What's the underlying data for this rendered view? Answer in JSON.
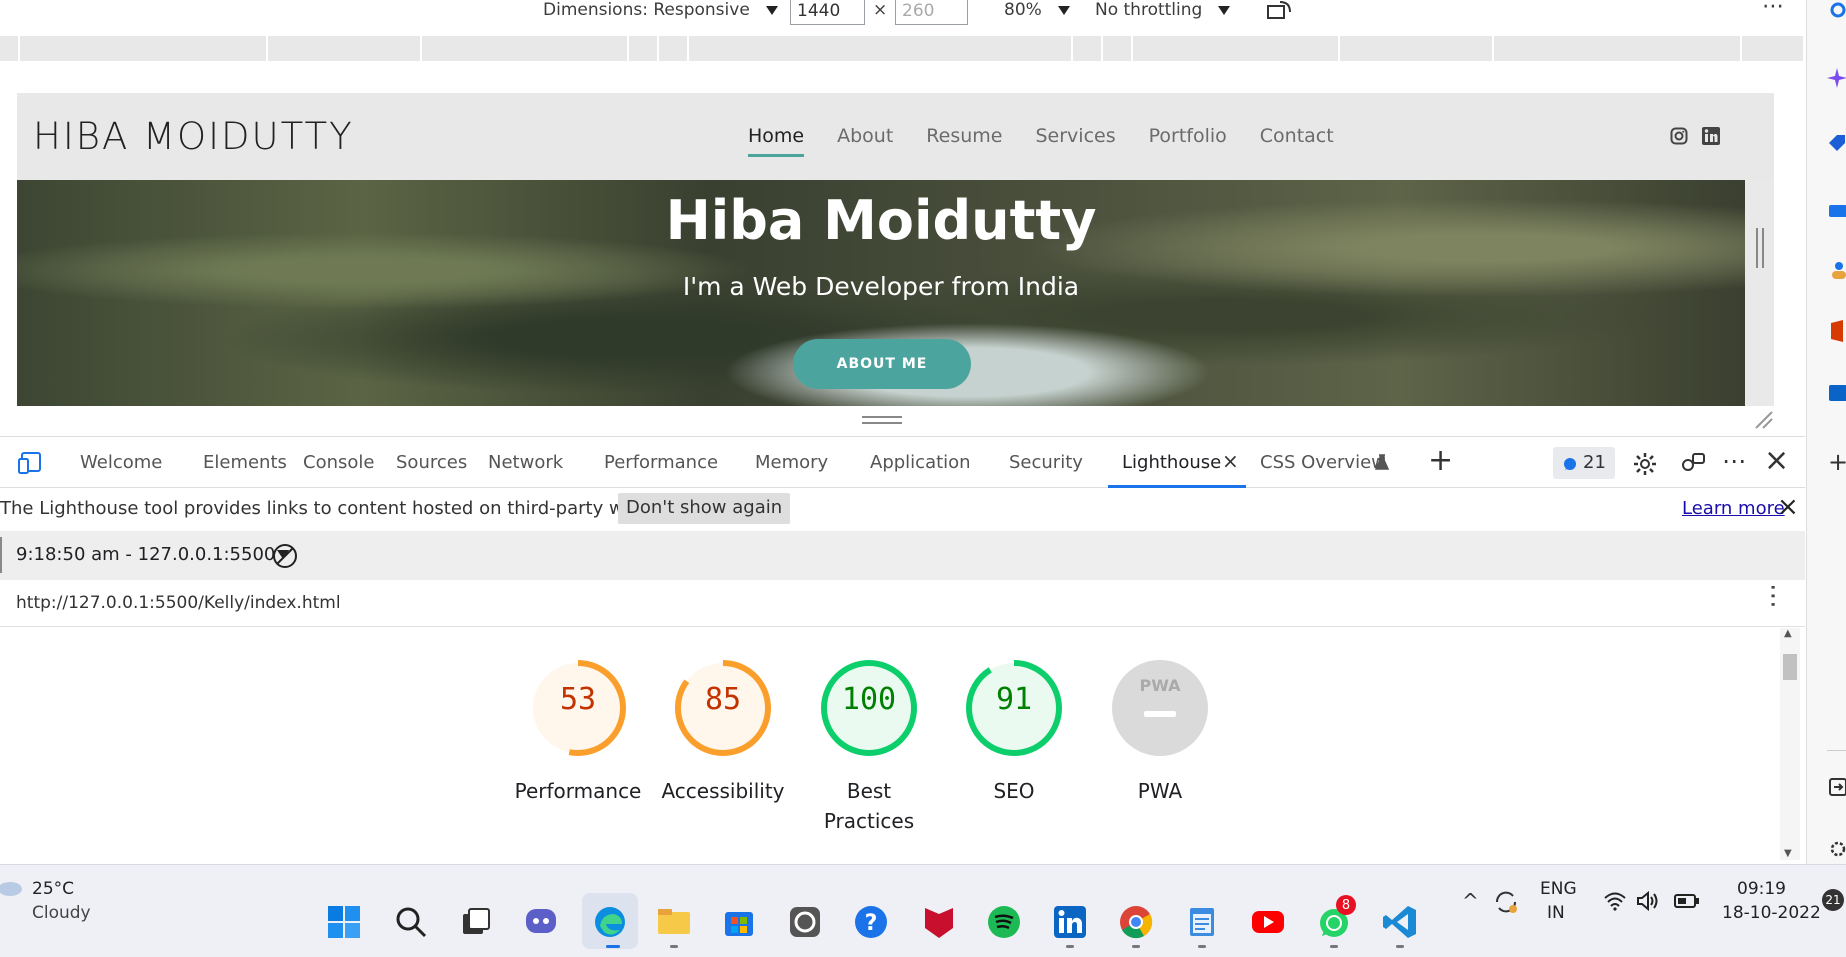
{
  "device_toolbar": {
    "dimensions_label": "Dimensions: Responsive",
    "width_value": "1440",
    "height_placeholder": "260",
    "times": "×",
    "zoom": "80%",
    "throttling": "No throttling"
  },
  "website": {
    "logo": "HIBA MOIDUTTY",
    "nav": [
      "Home",
      "About",
      "Resume",
      "Services",
      "Portfolio",
      "Contact"
    ],
    "hero_title": "Hiba Moidutty",
    "hero_subtitle": "I'm a Web Developer from India",
    "about_button": "ABOUT ME",
    "accent_color": "#4ba59e"
  },
  "devtools": {
    "tabs": [
      "Welcome",
      "Elements",
      "Console",
      "Sources",
      "Network",
      "Performance",
      "Memory",
      "Application",
      "Security",
      "Lighthouse",
      "CSS Overview"
    ],
    "active_tab": "Lighthouse",
    "issues_count": "21",
    "info_message": "The Lighthouse tool provides links to content hosted on third-party websites.",
    "dont_show_label": "Don't show again",
    "learn_more_label": "Learn more",
    "report_selector": "9:18:50 am - 127.0.0.1:5500",
    "report_url": "http://127.0.0.1:5500/Kelly/index.html"
  },
  "lighthouse_scores": [
    {
      "label": "Performance",
      "score": "53",
      "color": "#fa9f2c",
      "fill": "#fff6ec",
      "text_color": "#c33300"
    },
    {
      "label": "Accessibility",
      "score": "85",
      "color": "#fa9f2c",
      "fill": "#fff6ec",
      "text_color": "#c33300"
    },
    {
      "label_line1": "Best",
      "label_line2": "Practices",
      "score": "100",
      "color": "#0cce6b",
      "fill": "#eafaf1",
      "text_color": "#008000"
    },
    {
      "label": "SEO",
      "score": "91",
      "color": "#0cce6b",
      "fill": "#eafaf1",
      "text_color": "#008000"
    },
    {
      "label": "PWA",
      "badge": "PWA",
      "color": "#dadada",
      "fill": "#dadada"
    }
  ],
  "taskbar": {
    "temperature": "25°C",
    "weather": "Cloudy",
    "language_line1": "ENG",
    "language_line2": "IN",
    "time": "09:19",
    "date": "18-10-2022",
    "notification_count": "21",
    "whatsapp_badge": "8"
  }
}
